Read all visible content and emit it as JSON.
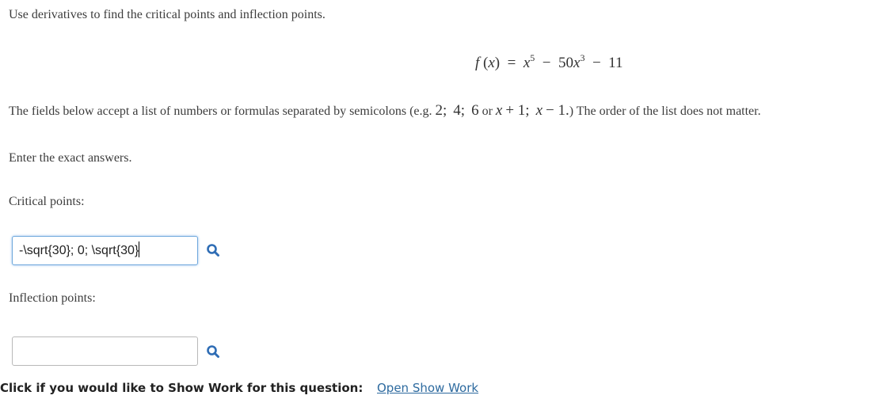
{
  "question": {
    "instruction": "Use derivatives to find the critical points and inflection points.",
    "formula": {
      "lhs_f": "f",
      "lhs_open": "(",
      "lhs_x": "x",
      "lhs_close": ")",
      "eq": "=",
      "t1_var": "x",
      "t1_exp": "5",
      "minus1": "−",
      "t2_coef": "50",
      "t2_var": "x",
      "t2_exp": "3",
      "minus2": "−",
      "t3": "11"
    },
    "fields_note": {
      "prefix": "The fields below accept a list of numbers or formulas separated by semicolons (e.g. ",
      "ex1": "2;",
      "ex2": "4;",
      "ex3": "6",
      "or": " or ",
      "ex4_var": "x",
      "ex4_rest": "+ 1;",
      "ex5_var": "x",
      "ex5_rest": "− 1.",
      "suffix": ") The order of the list does not matter."
    },
    "exact_note": "Enter the exact answers."
  },
  "critical": {
    "label": "Critical points:",
    "value": "-\\sqrt{30}; 0; \\sqrt{30}"
  },
  "inflection": {
    "label": "Inflection points:",
    "value": ""
  },
  "showwork": {
    "prompt": "Click if you would like to Show Work for this question:",
    "link": "Open Show Work"
  },
  "colors": {
    "link": "#2d6a9f",
    "icon": "#2f6db5",
    "focus_border": "#6fa8dc"
  },
  "icons": {
    "preview": "magnifier-icon"
  }
}
